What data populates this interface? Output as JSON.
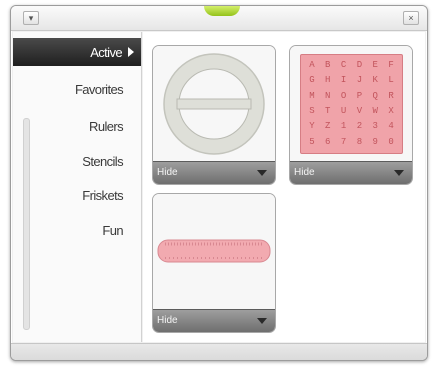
{
  "titlebar": {
    "menu_icon": "▾",
    "close_icon": "×"
  },
  "sidebar": {
    "items": [
      {
        "label": "Active",
        "active": true
      },
      {
        "label": "Favorites"
      },
      {
        "label": "Rulers"
      },
      {
        "label": "Stencils"
      },
      {
        "label": "Friskets"
      },
      {
        "label": "Fun"
      }
    ]
  },
  "content": {
    "thumbnails": [
      {
        "name": "Ellipse Stencil",
        "visibility": "Hide"
      },
      {
        "name": "Alphabet Stencil",
        "visibility": "Hide"
      },
      {
        "name": "Ruler",
        "visibility": "Hide"
      }
    ],
    "alphabet": [
      "A",
      "B",
      "C",
      "D",
      "E",
      "F",
      "G",
      "H",
      "I",
      "J",
      "K",
      "L",
      "M",
      "N",
      "O",
      "P",
      "Q",
      "R",
      "S",
      "T",
      "U",
      "V",
      "W",
      "X",
      "Y",
      "Z",
      "1",
      "2",
      "3",
      "4",
      "5",
      "6",
      "7",
      "8",
      "9",
      "0"
    ]
  },
  "colors": {
    "accent_grip": "#a8d42a",
    "active_bg": "#2a2a2a",
    "stencil_pink": "#f0a3a9"
  }
}
